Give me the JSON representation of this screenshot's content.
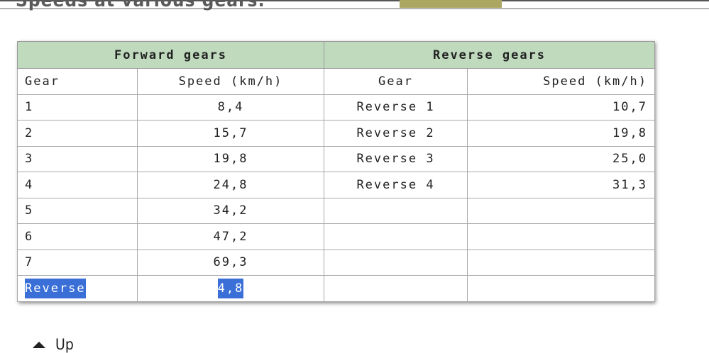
{
  "page": {
    "heading": "Speeds at various gears:",
    "up_link": "Up"
  },
  "table": {
    "groups": [
      "Forward gears",
      "Reverse gears"
    ],
    "headers": [
      "Gear",
      "Speed (km/h)",
      "Gear",
      "Speed (km/h)"
    ],
    "rows": [
      [
        "1",
        "8,4",
        "Reverse 1",
        "10,7"
      ],
      [
        "2",
        "15,7",
        "Reverse 2",
        "19,8"
      ],
      [
        "3",
        "19,8",
        "Reverse 3",
        "25,0"
      ],
      [
        "4",
        "24,8",
        "Reverse 4",
        "31,3"
      ],
      [
        "5",
        "34,2",
        "",
        ""
      ],
      [
        "6",
        "47,2",
        "",
        ""
      ],
      [
        "7",
        "69,3",
        "",
        ""
      ],
      [
        "Reverse",
        "4,8",
        "",
        ""
      ]
    ]
  },
  "colors": {
    "group_header_bg": "#bfdabd",
    "selection_bg": "#3a6fd8",
    "tab_accent": "#aca663"
  }
}
